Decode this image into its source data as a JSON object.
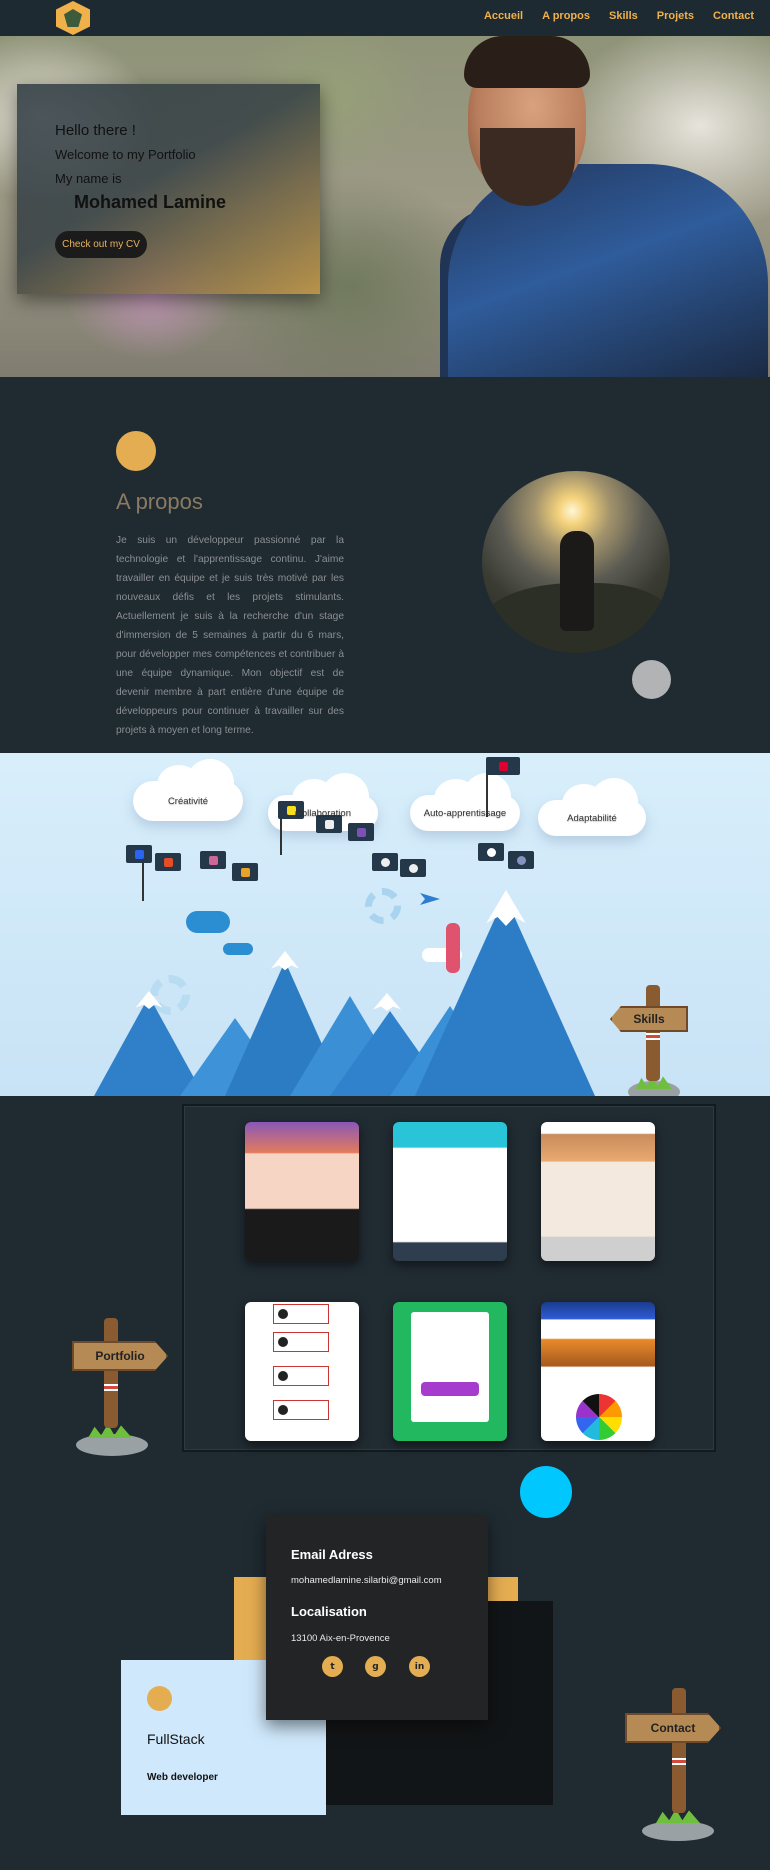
{
  "nav": {
    "links": [
      "Accueil",
      "A propos",
      "Skills",
      "Projets",
      "Contact"
    ]
  },
  "hero": {
    "line1": "Hello there !",
    "line2": "Welcome to my Portfolio",
    "line3": "My name is",
    "name": "Mohamed Lamine",
    "cv_button": "Check out my CV"
  },
  "about": {
    "title": "A propos",
    "text": "Je suis un développeur passionné par la technologie et l'apprentissage continu. J'aime travailler en équipe et je suis très motivé par les nouveaux défis et les projets stimulants. Actuellement je suis à la recherche d'un stage d'immersion de 5 semaines à partir du 6 mars, pour développer mes compétences et contribuer à une équipe dynamique. Mon objectif est de devenir membre à part entière d'une équipe de développeurs pour continuer à travailler sur des projets à moyen et long terme."
  },
  "skills": {
    "soft": [
      "Créativité",
      "Collaboration",
      "Auto-apprentissage",
      "Adaptabilité"
    ],
    "sign": "Skills",
    "flag_icons": [
      "css-icon",
      "html-icon",
      "sass-icon",
      "js-icon",
      "github-icon",
      "bootstrap-icon",
      "wordpress-icon",
      "react-icon",
      "php-icon",
      "angular-icon",
      "nextjs-icon",
      "photoshop-icon"
    ]
  },
  "portfolio": {
    "sign": "Portfolio",
    "projects": [
      "project-1",
      "project-2",
      "project-3",
      "project-4",
      "project-5",
      "project-6"
    ]
  },
  "contact": {
    "email_label": "Email Adress",
    "email": "mohamedlamine.silarbi@gmail.com",
    "location_label": "Localisation",
    "location": "13100 Aix-en-Provence",
    "fullstack": "FullStack",
    "role": "Web developer",
    "sign": "Contact",
    "socials": [
      "twitter-icon",
      "github-icon",
      "linkedin-icon"
    ]
  },
  "colors": {
    "accent": "#e5ad52",
    "background": "#1f2a31",
    "cyan": "#00c8ff",
    "sky": "#d8eefb"
  }
}
